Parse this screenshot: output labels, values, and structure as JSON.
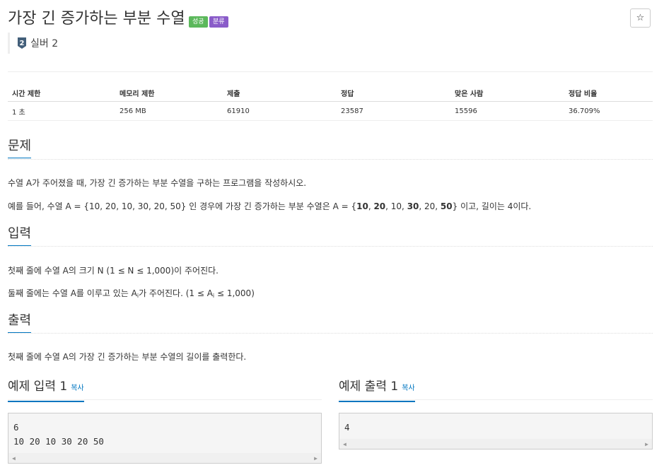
{
  "problem": {
    "title": "가장 긴 증가하는 부분 수열",
    "badges": [
      "성공",
      "분류"
    ],
    "star": "☆",
    "tier": "실버 2",
    "tier_number": "2"
  },
  "stats": {
    "headers": [
      "시간 제한",
      "메모리 제한",
      "제출",
      "정답",
      "맞은 사람",
      "정답 비율"
    ],
    "values": [
      "1 초",
      "256 MB",
      "61910",
      "23587",
      "15596",
      "36.709%"
    ]
  },
  "sections": {
    "problem_title": "문제",
    "problem_p1": "수열 A가 주어졌을 때, 가장 긴 증가하는 부분 수열을 구하는 프로그램을 작성하시오.",
    "problem_p2_parts": [
      "예를 들어, 수열 A = {10, 20, 10, 30, 20, 50} 인 경우에 가장 긴 증가하는 부분 수열은 A = {",
      "10",
      ", ",
      "20",
      ", 10, ",
      "30",
      ", 20, ",
      "50",
      "} 이고, 길이는 4이다."
    ],
    "input_title": "입력",
    "input_p1": "첫째 줄에 수열 A의 크기 N (1 ≤ N ≤ 1,000)이 주어진다.",
    "input_p2_parts": [
      "둘째 줄에는 수열 A를 이루고 있는 A",
      "i",
      "가 주어진다. (1 ≤ A",
      "i",
      " ≤ 1,000)"
    ],
    "output_title": "출력",
    "output_p1": "첫째 줄에 수열 A의 가장 긴 증가하는 부분 수열의 길이를 출력한다."
  },
  "examples": {
    "input_title": "예제 입력 1",
    "output_title": "예제 출력 1",
    "copy_label": "복사",
    "input_text": "6\n10 20 10 30 20 50",
    "output_text": "4"
  },
  "colors": {
    "success": "#5cb85c",
    "category": "#8a5cc9",
    "accent": "#0076c0",
    "tier": "#435f7a"
  }
}
